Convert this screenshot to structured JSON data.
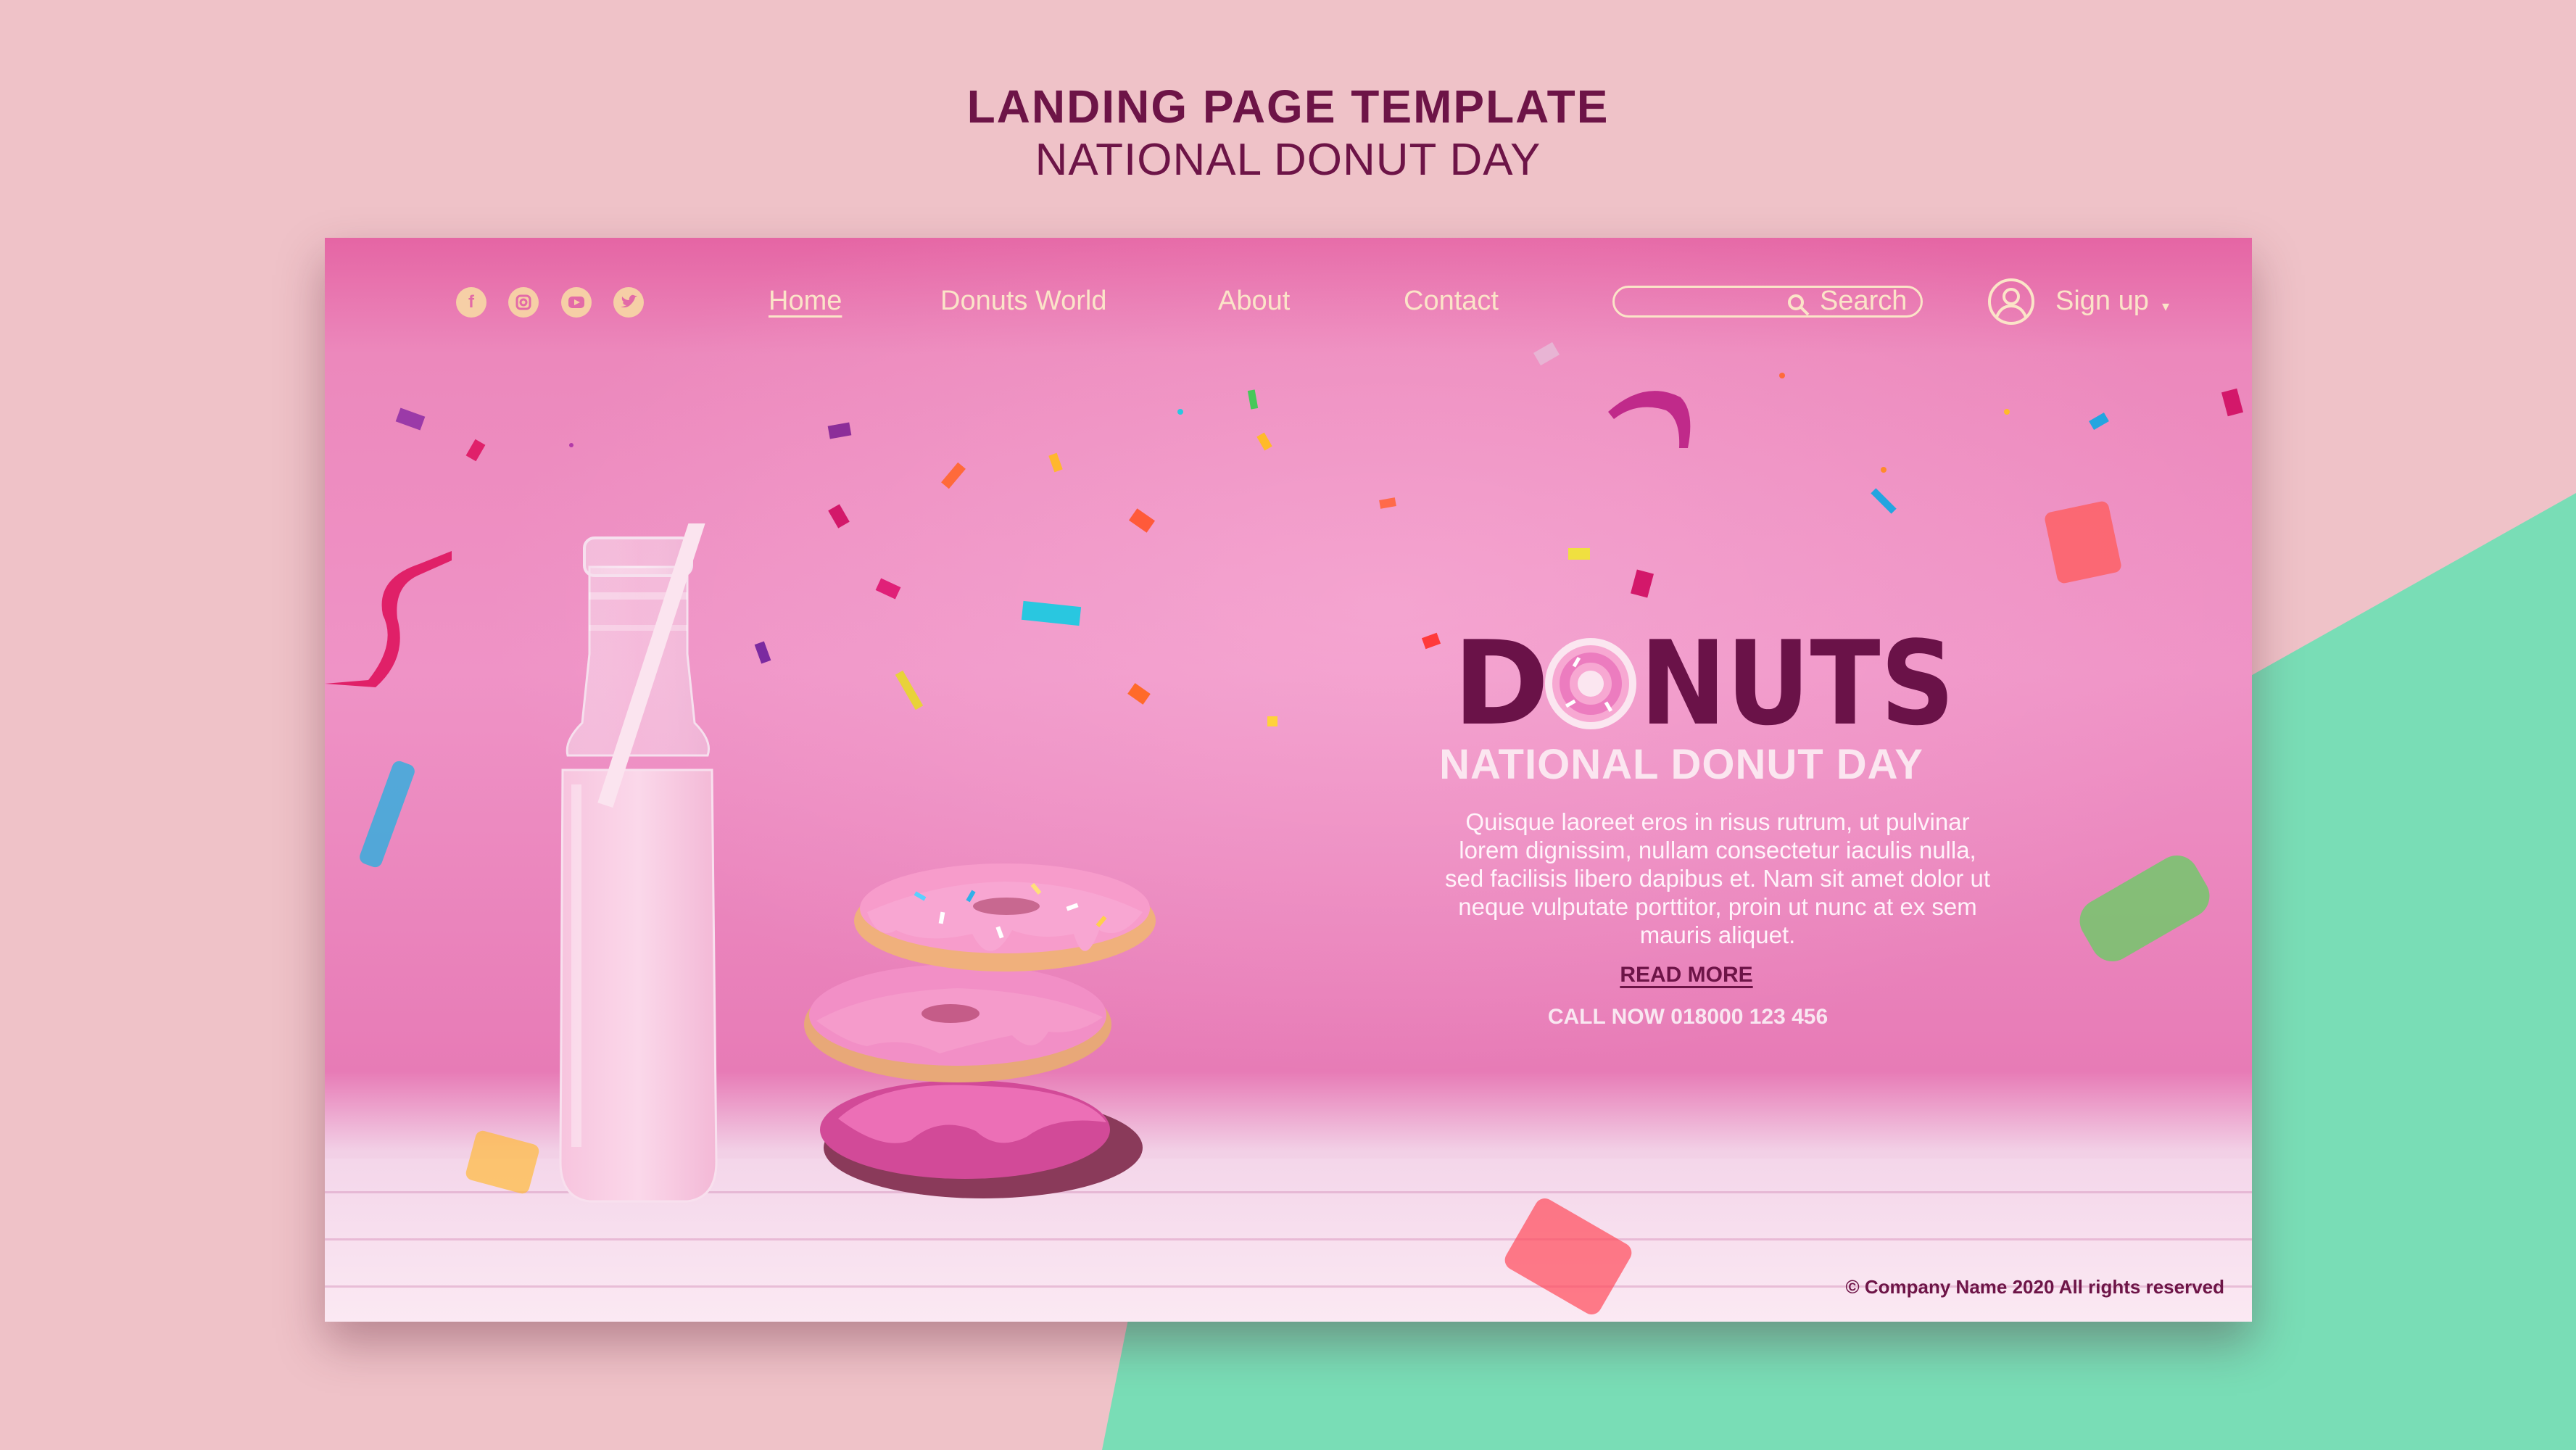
{
  "template": {
    "title": "LANDING PAGE TEMPLATE",
    "subtitle": "NATIONAL DONUT DAY"
  },
  "social": {
    "icons": [
      "facebook-icon",
      "instagram-icon",
      "youtube-icon",
      "twitter-icon"
    ]
  },
  "nav": {
    "items": [
      {
        "label": "Home",
        "active": true
      },
      {
        "label": "Donuts World",
        "active": false
      },
      {
        "label": "About",
        "active": false
      },
      {
        "label": "Contact",
        "active": false
      }
    ]
  },
  "search": {
    "placeholder": "Search"
  },
  "account": {
    "signup_label": "Sign up",
    "caret": "▾"
  },
  "hero": {
    "logo_text": "DONUTS",
    "subheading": "NATIONAL DONUT DAY",
    "body": "Quisque laoreet eros in risus rutrum, ut pulvinar lorem dignissim, nullam consectetur iaculis nulla, sed facilisis libero dapibus et. Nam sit amet dolor ut neque vulputate porttitor, proin ut nunc at ex sem mauris aliquet.",
    "cta_label": "READ MORE",
    "call_label": "CALL NOW 018000 123 456"
  },
  "footer": {
    "copyright": "© Company Name 2020 All rights reserved"
  },
  "colors": {
    "brand_purple": "#6d1447",
    "hero_pink": "#ec88bc",
    "nav_text": "#fbe4c8",
    "background_orange": "#fabd6b",
    "background_pink": "#efc2c8",
    "background_mint": "#79ddb6"
  }
}
